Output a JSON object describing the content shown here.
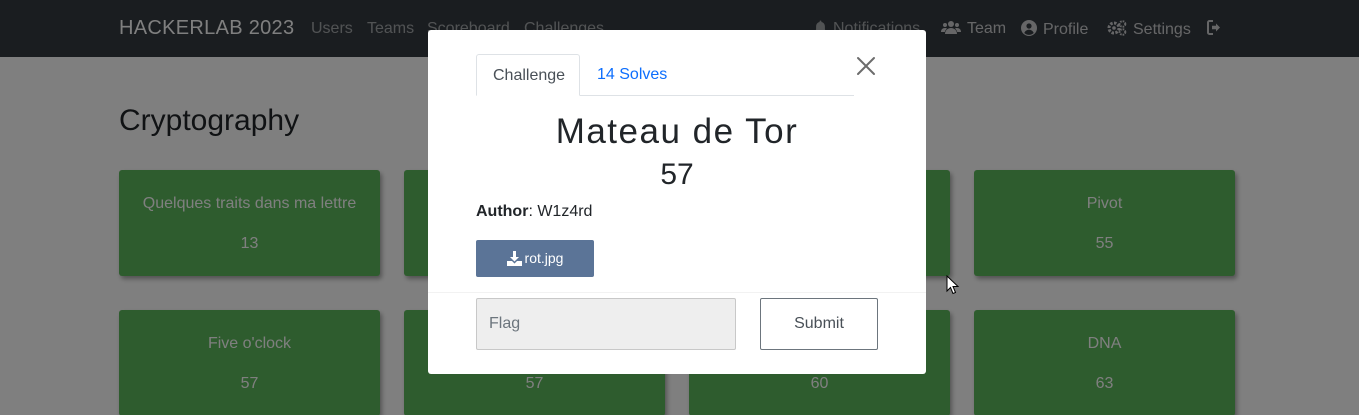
{
  "navbar": {
    "brand": "HACKERLAB 2023",
    "links": [
      "Users",
      "Teams",
      "Scoreboard",
      "Challenges"
    ],
    "right": [
      {
        "label": "Notifications",
        "icon": "bell-icon"
      },
      {
        "label": "Team",
        "icon": "users-icon"
      },
      {
        "label": "Profile",
        "icon": "user-circle-icon"
      },
      {
        "label": "Settings",
        "icon": "cogs-icon"
      },
      {
        "label": "",
        "icon": "logout-icon"
      }
    ]
  },
  "page": {
    "category": "Cryptography",
    "cards": [
      {
        "name": "Quelques traits dans ma lettre",
        "value": "13"
      },
      {
        "name": "",
        "value": ""
      },
      {
        "name": "",
        "value": ""
      },
      {
        "name": "Pivot",
        "value": "55"
      },
      {
        "name": "Five o'clock",
        "value": "57"
      },
      {
        "name": "",
        "value": "57"
      },
      {
        "name": "",
        "value": "60"
      },
      {
        "name": "DNA",
        "value": "63"
      }
    ],
    "card_color": "#5cb85c"
  },
  "modal": {
    "tabs": {
      "challenge": "Challenge",
      "solves": "14 Solves"
    },
    "name": "Mateau de Tor",
    "value": "57",
    "author_label": "Author",
    "author": "W1z4rd",
    "file": "rot.jpg",
    "flag_placeholder": "Flag",
    "submit": "Submit"
  }
}
